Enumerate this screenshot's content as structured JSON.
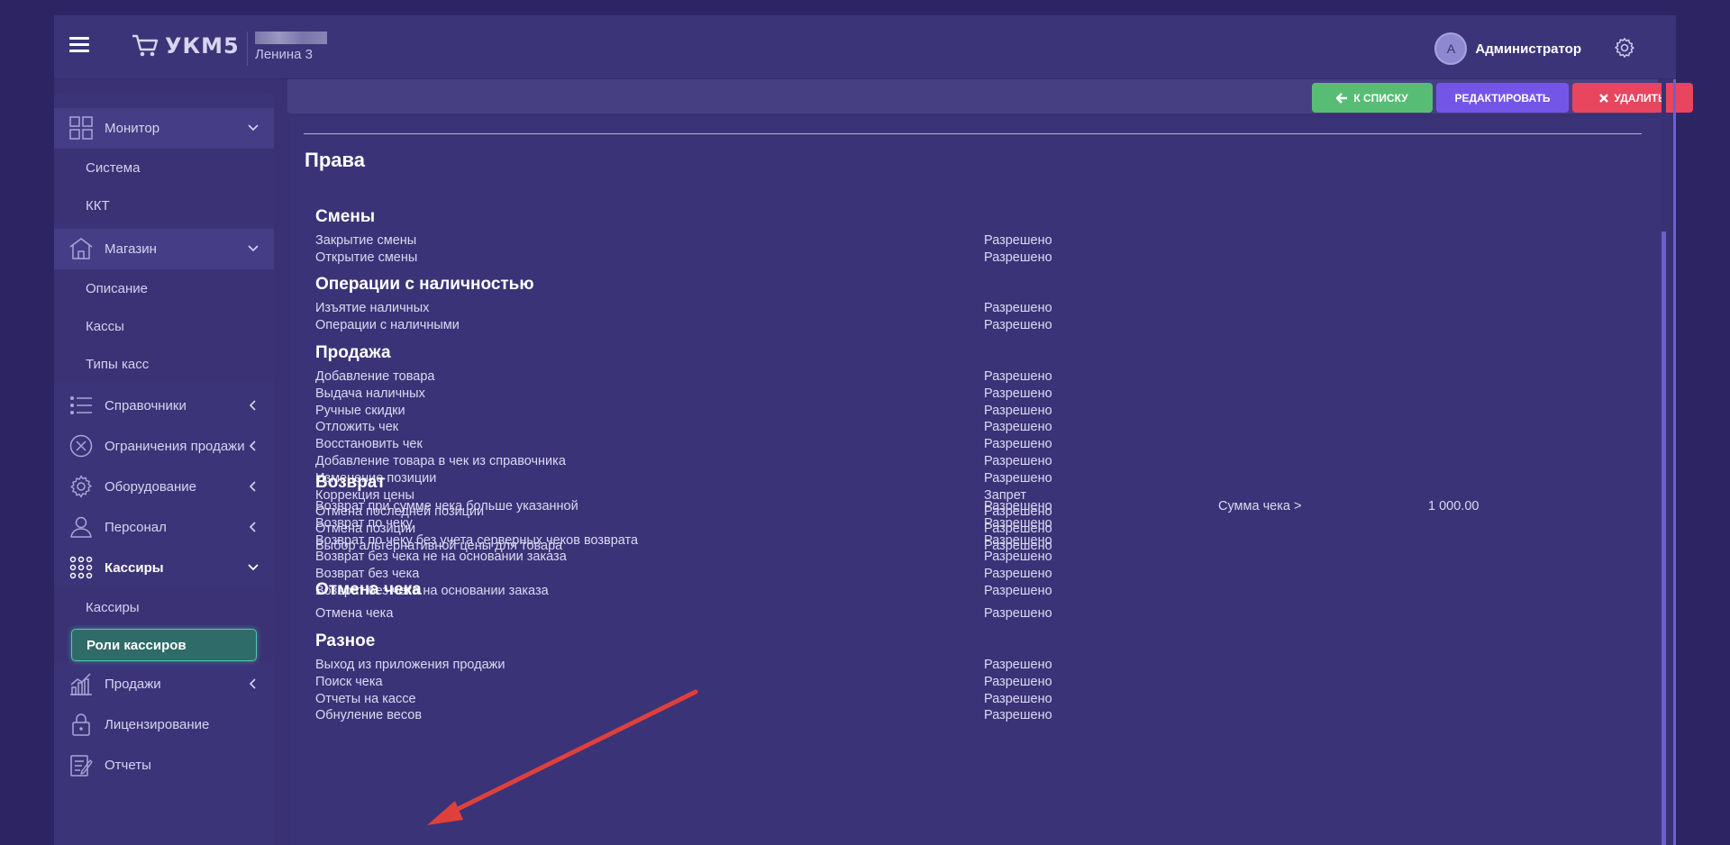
{
  "header": {
    "app_name": "УКМ5",
    "store_name": "Ленина 3",
    "user_initial": "А",
    "user_name": "Администратор"
  },
  "sidebar": {
    "groups": [
      {
        "label": "Монитор",
        "icon": "monitor-grid-icon",
        "sub": [
          "Система",
          "ККТ"
        ]
      },
      {
        "label": "Магазин",
        "icon": "store-icon",
        "sub": [
          "Описание",
          "Кассы",
          "Типы касс"
        ]
      },
      {
        "label": "Справочники",
        "icon": "list-icon"
      },
      {
        "label": "Ограничения продажи",
        "icon": "restriction-icon"
      },
      {
        "label": "Оборудование",
        "icon": "equipment-gear-icon"
      },
      {
        "label": "Персонал",
        "icon": "person-icon"
      },
      {
        "label": "Кассиры",
        "icon": "cashiers-grid-icon",
        "sub": [
          "Кассиры",
          "Роли кассиров"
        ],
        "active_sub": "Роли кассиров"
      },
      {
        "label": "Продажи",
        "icon": "sales-chart-icon"
      },
      {
        "label": "Лицензирование",
        "icon": "lock-icon"
      },
      {
        "label": "Отчеты",
        "icon": "reports-icon"
      }
    ]
  },
  "toolbar": {
    "back_label": "К СПИСКУ",
    "edit_label": "РЕДАКТИРОВАТЬ",
    "delete_label": "УДАЛИТЬ"
  },
  "colors": {
    "back_button": "#58bd74",
    "edit_button": "#7356e8",
    "delete_button": "#e8455e",
    "active_menu": "#2f6b68",
    "annotation_arrow": "#e0403a"
  },
  "content": {
    "title": "Права",
    "sections": [
      {
        "name": "Смены",
        "rows": [
          {
            "name": "Закрытие смены",
            "value": "Разрешено"
          },
          {
            "name": "Открытие смены",
            "value": "Разрешено"
          }
        ]
      },
      {
        "name": "Операции с наличностью",
        "rows": [
          {
            "name": "Изъятие наличных",
            "value": "Разрешено"
          },
          {
            "name": "Операции с наличными",
            "value": "Разрешено"
          }
        ]
      },
      {
        "name": "Продажа",
        "rows": [
          {
            "name": "Добавление товара",
            "value": "Разрешено"
          },
          {
            "name": "Выдача наличных",
            "value": "Разрешено"
          },
          {
            "name": "Ручные скидки",
            "value": "Разрешено"
          },
          {
            "name": "Отложить чек",
            "value": "Разрешено"
          },
          {
            "name": "Восстановить чек",
            "value": "Разрешено"
          },
          {
            "name": "Добавление товара в чек из справочника",
            "value": "Разрешено"
          },
          {
            "name": "Изменение позиции",
            "value": "Разрешено"
          },
          {
            "name": "Коррекция цены",
            "value": "Запрет"
          },
          {
            "name": "Отмена последней позиции",
            "value": "Разрешено"
          },
          {
            "name": "Отмена позиции",
            "value": "Разрешено"
          },
          {
            "name": "Выбор альтернативной цены для товара",
            "value": "Разрешено"
          }
        ]
      },
      {
        "name": "Возврат",
        "rows": [
          {
            "name": "Возврат при сумме чека больше указанной",
            "value": "Разрешено",
            "extra_label": "Сумма чека >",
            "extra_value": "1 000.00"
          },
          {
            "name": "Возврат по чеку",
            "value": "Разрешено"
          },
          {
            "name": "Возврат по чеку без учета серверных чеков возврата",
            "value": "Разрешено"
          },
          {
            "name": "Возврат без чека не на основании заказа",
            "value": "Разрешено"
          },
          {
            "name": "Возврат без чека",
            "value": "Разрешено"
          },
          {
            "name": "Возврат без чека на основании заказа",
            "value": "Разрешено"
          }
        ]
      },
      {
        "name": "Отмена чека",
        "rows": [
          {
            "name": "Отмена чека",
            "value": "Разрешено"
          }
        ]
      },
      {
        "name": "Разное",
        "rows": [
          {
            "name": "Выход из приложения продажи",
            "value": "Разрешено"
          },
          {
            "name": "Поиск чека",
            "value": "Разрешено"
          },
          {
            "name": "Отчеты на кассе",
            "value": "Разрешено"
          },
          {
            "name": "Обнуление весов",
            "value": "Разрешено"
          }
        ]
      }
    ]
  }
}
